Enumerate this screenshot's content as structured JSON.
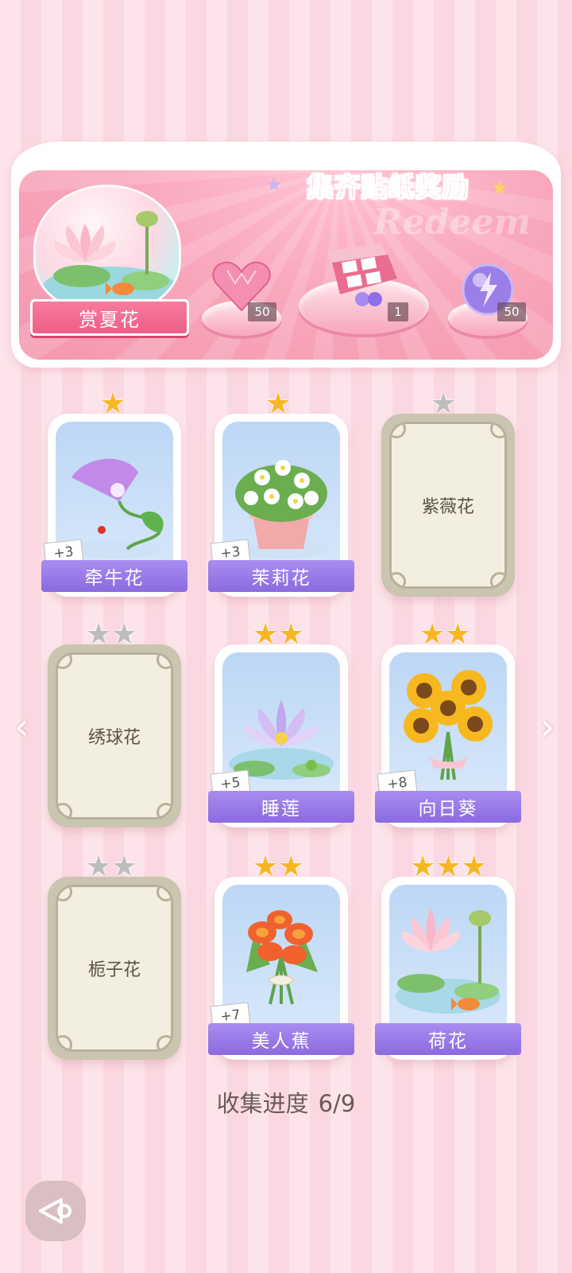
{
  "banner": {
    "title": "集齐贴纸奖励",
    "watermark": "Redeem",
    "theme_name": "赏夏花",
    "rewards": [
      {
        "icon": "pink-heart-gem-icon",
        "count": "50"
      },
      {
        "icon": "gift-box-icon",
        "count": "1"
      },
      {
        "icon": "energy-orb-icon",
        "count": "50"
      }
    ]
  },
  "cards": [
    {
      "name": "牵牛花",
      "stars": 1,
      "collected": true,
      "bonus": "+3",
      "icon": "morning-glory-icon"
    },
    {
      "name": "茉莉花",
      "stars": 1,
      "collected": true,
      "bonus": "+3",
      "icon": "jasmine-icon"
    },
    {
      "name": "紫薇花",
      "stars": 1,
      "collected": false,
      "bonus": "",
      "icon": ""
    },
    {
      "name": "绣球花",
      "stars": 2,
      "collected": false,
      "bonus": "",
      "icon": ""
    },
    {
      "name": "睡莲",
      "stars": 2,
      "collected": true,
      "bonus": "+5",
      "icon": "water-lily-icon"
    },
    {
      "name": "向日葵",
      "stars": 2,
      "collected": true,
      "bonus": "+8",
      "icon": "sunflower-icon"
    },
    {
      "name": "栀子花",
      "stars": 2,
      "collected": false,
      "bonus": "",
      "icon": ""
    },
    {
      "name": "美人蕉",
      "stars": 2,
      "collected": true,
      "bonus": "+7",
      "icon": "canna-icon"
    },
    {
      "name": "荷花",
      "stars": 3,
      "collected": true,
      "bonus": "",
      "icon": "lotus-icon"
    }
  ],
  "progress": {
    "label": "收集进度",
    "value": "6/9"
  },
  "nav": {
    "prev": "‹",
    "next": "›"
  }
}
